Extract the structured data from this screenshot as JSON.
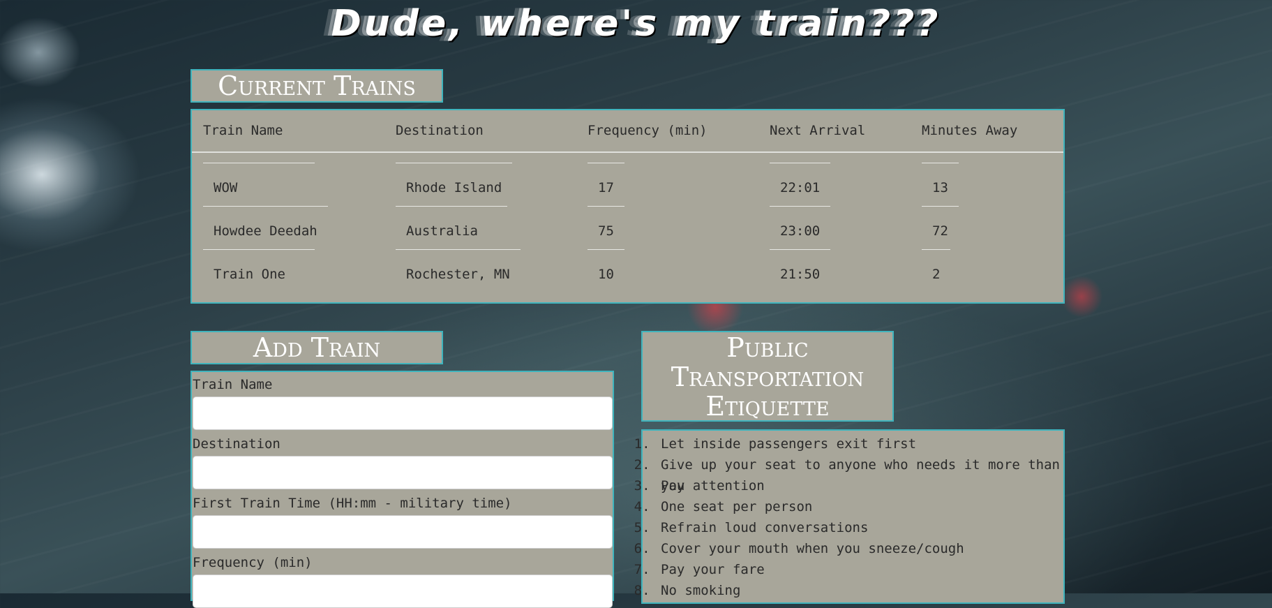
{
  "page": {
    "title": "Dude, where's my train???"
  },
  "current_trains": {
    "heading": "Current Trains",
    "columns": [
      "Train Name",
      "Destination",
      "Frequency (min)",
      "Next Arrival",
      "Minutes Away"
    ],
    "rows": [
      [
        "WOW",
        "Rhode Island",
        "17",
        "22:01",
        "13"
      ],
      [
        "Howdee Deedah",
        "Australia",
        "75",
        "23:00",
        "72"
      ],
      [
        "Train One",
        "Rochester, MN",
        "10",
        "21:50",
        "2"
      ]
    ]
  },
  "add_train": {
    "heading": "Add Train",
    "fields": [
      {
        "label": "Train Name"
      },
      {
        "label": "Destination"
      },
      {
        "label": "First Train Time (HH:mm - military time)"
      },
      {
        "label": "Frequency (min)"
      }
    ]
  },
  "etiquette": {
    "heading_line1": "Public",
    "heading_line2": "Transportation",
    "heading_line3": "Etiquette",
    "items": [
      "Let inside passengers exit first",
      "Give up your seat to anyone who needs it more than you",
      "Pay attention",
      "One seat per person",
      "Refrain loud conversations",
      "Cover your mouth when you sneeze/cough",
      "Pay your fare",
      "No smoking"
    ]
  },
  "colors": {
    "panel": "#a8a69a",
    "border": "#3fb4bd",
    "heading_text": "#ffffff"
  }
}
